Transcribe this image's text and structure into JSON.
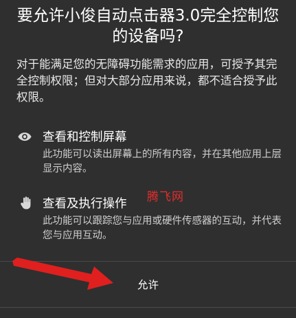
{
  "dialog": {
    "title": "要允许小俊自动点击器3.0完全控制您的设备吗?",
    "description": "对于能满足您的无障碍功能需求的应用，可授予其完全控制权限；但对大部分应用来说，都不适合授予此权限。",
    "permissions": [
      {
        "icon": "eye-icon",
        "title": "查看和控制屏幕",
        "description": "此功能可以读出屏幕上的所有内容，并在其他应用上层显示内容。"
      },
      {
        "icon": "hand-icon",
        "title": "查看及执行操作",
        "description": "此功能可以跟踪您与应用或硬件传感器的互动，并代表您与应用互动。"
      }
    ],
    "allow_label": "允许"
  },
  "watermark": "腾飞网",
  "colors": {
    "background": "#2f2f2f",
    "text": "#ffffff",
    "secondary_text": "#cfcfcf",
    "arrow": "#e01f1f",
    "watermark": "#e32d2d"
  }
}
